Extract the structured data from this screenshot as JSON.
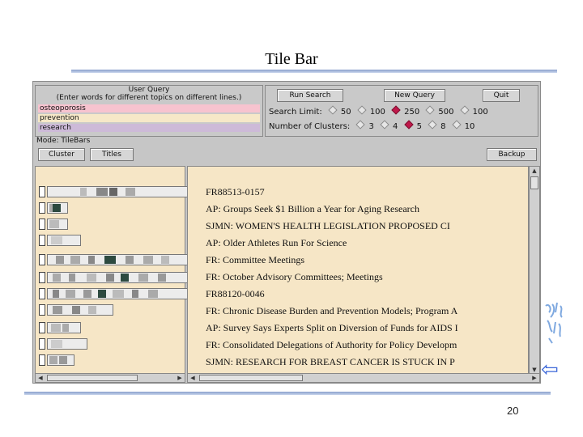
{
  "slide": {
    "title": "Tile Bar",
    "page_number": "20",
    "back_arrow": "⇦"
  },
  "app": {
    "user_query": {
      "heading_line1": "User Query",
      "heading_line2": "(Enter words for different topics on different lines.)",
      "lines": [
        "osteoporosis",
        "prevention",
        "research"
      ],
      "line_colors": [
        "#f7c3cf",
        "#f6e8c8",
        "#cdbad8"
      ]
    },
    "buttons": {
      "run_search": "Run Search",
      "new_query": "New Query",
      "quit": "Quit",
      "cluster": "Cluster",
      "titles": "Titles",
      "backup": "Backup"
    },
    "search_limit": {
      "label": "Search Limit:",
      "options": [
        "50",
        "100",
        "250",
        "500",
        "100"
      ],
      "selected": "250"
    },
    "clusters": {
      "label": "Number of Clusters:",
      "options": [
        "3",
        "4",
        "5",
        "8",
        "10"
      ],
      "selected": "5"
    },
    "mode": "Mode: TileBars",
    "results": [
      "FR88513-0157",
      "AP: Groups Seek $1 Billion a Year for Aging Research",
      "SJMN: WOMEN'S HEALTH LEGISLATION PROPOSED CI",
      "AP: Older Athletes Run For Science",
      "FR: Committee Meetings",
      "FR: October Advisory Committees; Meetings",
      "FR88120-0046",
      "FR: Chronic Disease Burden and Prevention Models; Program A",
      "AP: Survey Says Experts Split on Diversion of Funds for AIDS I",
      "FR: Consolidated Delegations of Authority for Policy Developm",
      "SJMN: RESEARCH FOR BREAST CANCER IS STUCK IN P"
    ]
  }
}
